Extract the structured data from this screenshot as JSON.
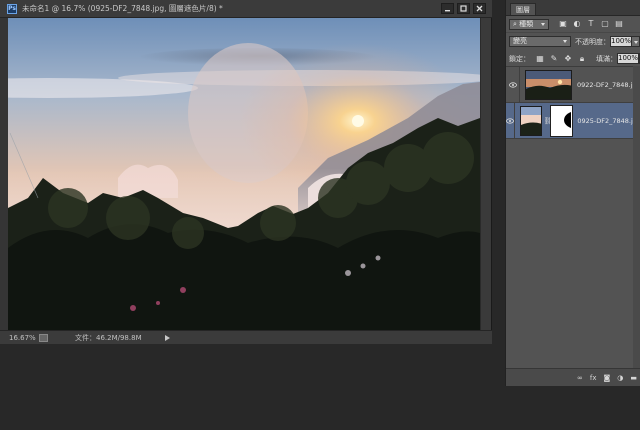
{
  "document": {
    "app_icon_label": "Ps",
    "title": "未命名1 @ 16.7% (0925-DF2_7848.jpg, 圖層遮色片/8) *",
    "status": {
      "zoom": "16.67%",
      "doc_size": "文件：46.2M/98.8M"
    }
  },
  "layers_panel": {
    "tab_label": "圖層",
    "filter_kind": "種類",
    "blend_mode": "變亮",
    "opacity_label": "不透明度：",
    "opacity_value": "100%",
    "lock_label": "鎖定：",
    "fill_label": "填滿：",
    "fill_value": "100%",
    "layers": [
      {
        "name": "0922-DF2_7848.jpg",
        "selected": false,
        "has_mask": false
      },
      {
        "name": "0925-DF2_7848.jpg",
        "selected": true,
        "has_mask": true
      }
    ],
    "footer_icons": [
      "link-icon",
      "fx-icon",
      "mask-icon",
      "adjustment-icon",
      "group-icon"
    ]
  }
}
